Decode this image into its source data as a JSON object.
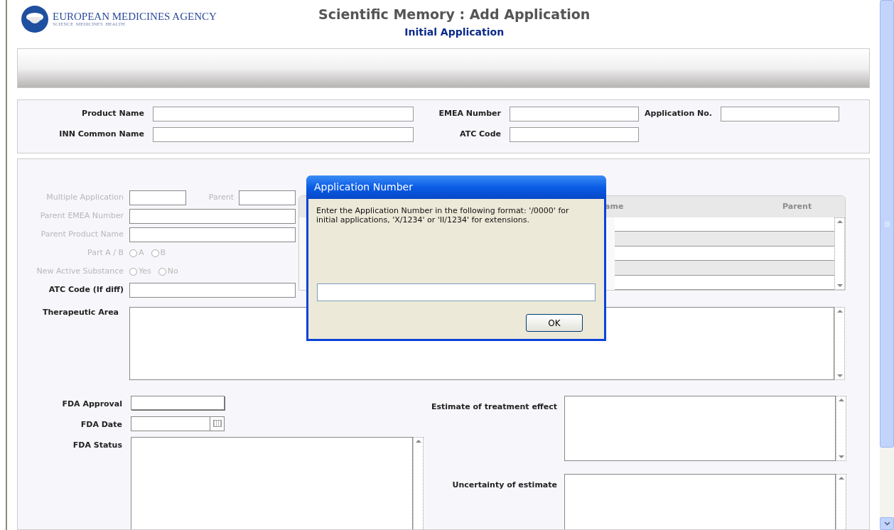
{
  "header": {
    "logo_name": "EUROPEAN MEDICINES AGENCY",
    "logo_tagline": "SCIENCE  MEDICINES  HEALTH",
    "title": "Scientific Memory : Add Application",
    "subtitle": "Initial Application"
  },
  "product_rows": [
    {
      "fields": [
        {
          "label": "Product Name"
        },
        {
          "label": "EMEA Number"
        },
        {
          "label": "Application No."
        }
      ]
    },
    {
      "fields": [
        {
          "label": "INN Common Name"
        },
        {
          "label": "ATC Code"
        }
      ]
    }
  ],
  "parent_fields": [
    {
      "kind": "pair",
      "label": "Multiple Application",
      "second_label": "Parent",
      "disabled": true
    },
    {
      "kind": "text",
      "label": "Parent EMEA Number",
      "disabled": true
    },
    {
      "kind": "text",
      "label": "Parent Product Name",
      "disabled": true
    },
    {
      "kind": "radio",
      "label": "Part A / B",
      "disabled": true,
      "options": [
        {
          "label": "A",
          "selected": false
        },
        {
          "label": "B",
          "selected": false
        }
      ]
    },
    {
      "kind": "radio",
      "label": "New Active Substance",
      "disabled": true,
      "options": [
        {
          "label": "Yes",
          "selected": false
        },
        {
          "label": "No",
          "selected": false
        }
      ]
    },
    {
      "kind": "text",
      "label": "ATC Code (If diff)",
      "disabled": false
    }
  ],
  "parent_grid": {
    "columns": [
      "ame",
      "Parent"
    ]
  },
  "therapeutic_area": {
    "label": "Therapeutic Area"
  },
  "fda_fields": [
    {
      "kind": "text",
      "label": "FDA Approval"
    },
    {
      "kind": "date",
      "label": "FDA Date"
    },
    {
      "kind": "textarea",
      "label": "FDA Status"
    }
  ],
  "estimate_fields": [
    {
      "label": "Estimate of treatment effect"
    },
    {
      "label": "Uncertainty of estimate"
    }
  ],
  "dialog": {
    "title": "Application Number",
    "message": "Enter the Application Number in the following format: '/0000' for initial applications, 'X/1234' or 'II/1234' for extensions.",
    "button": "OK"
  }
}
